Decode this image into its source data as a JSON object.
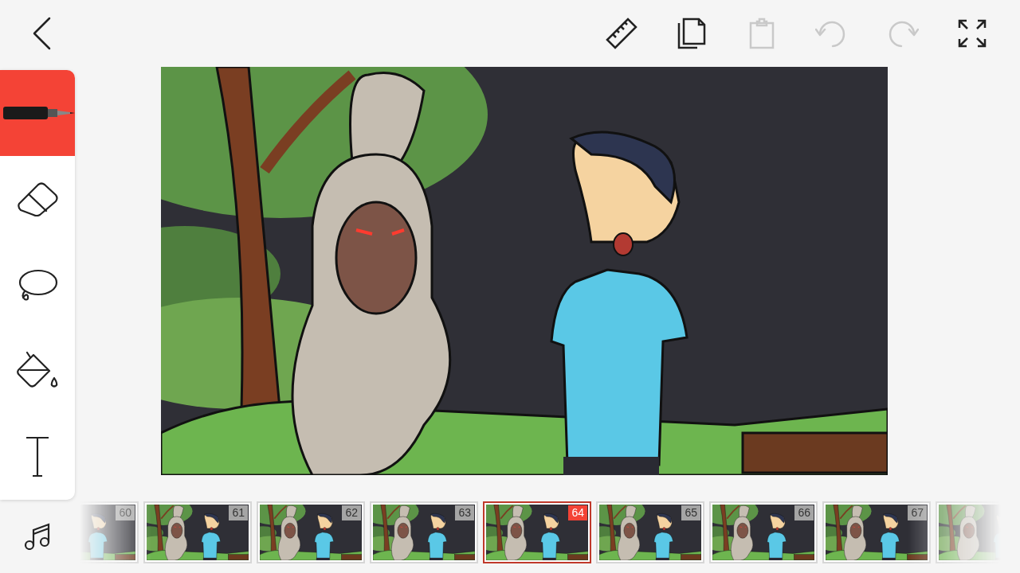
{
  "actions": [
    {
      "kind": "ruler",
      "disabled": false
    },
    {
      "kind": "copy",
      "disabled": false
    },
    {
      "kind": "paste",
      "disabled": true
    },
    {
      "kind": "undo",
      "disabled": true
    },
    {
      "kind": "redo",
      "disabled": true
    },
    {
      "kind": "fullscreen",
      "disabled": false
    }
  ],
  "tools": [
    {
      "kind": "pen",
      "selected": true
    },
    {
      "kind": "eraser",
      "selected": false
    },
    {
      "kind": "lasso",
      "selected": false
    },
    {
      "kind": "fill",
      "selected": false
    },
    {
      "kind": "text",
      "selected": false
    }
  ],
  "frames": [
    {
      "number": "60",
      "selected": false
    },
    {
      "number": "61",
      "selected": false
    },
    {
      "number": "62",
      "selected": false
    },
    {
      "number": "63",
      "selected": false
    },
    {
      "number": "64",
      "selected": true
    },
    {
      "number": "65",
      "selected": false
    },
    {
      "number": "66",
      "selected": false
    },
    {
      "number": "67",
      "selected": false
    }
  ]
}
